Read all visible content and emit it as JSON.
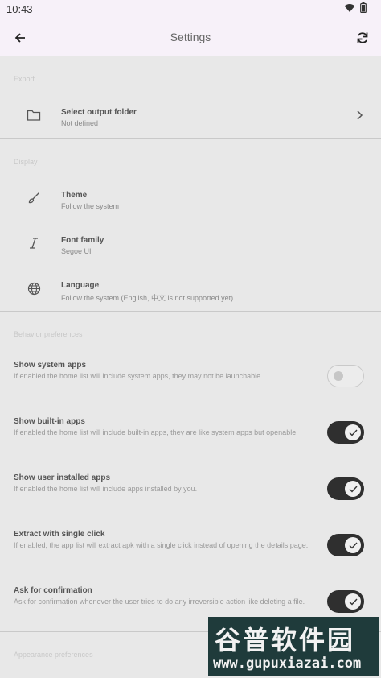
{
  "status_bar": {
    "time": "10:43"
  },
  "appbar": {
    "title": "Settings"
  },
  "export": {
    "label": "Export",
    "items": [
      {
        "title": "Select output folder",
        "subtitle": "Not defined"
      }
    ]
  },
  "display": {
    "label": "Display",
    "items": [
      {
        "title": "Theme",
        "subtitle": "Follow the system"
      },
      {
        "title": "Font family",
        "subtitle": "Segoe UI"
      },
      {
        "title": "Language",
        "subtitle": "Follow the system (English, 中文 is not supported yet)"
      }
    ]
  },
  "behavior": {
    "label": "Behavior preferences",
    "items": [
      {
        "title": "Show system apps",
        "description": "If enabled the home list will include system apps, they may not be launchable.",
        "enabled": false
      },
      {
        "title": "Show built-in apps",
        "description": "If enabled the home list will include built-in apps, they are like system apps but openable.",
        "enabled": true
      },
      {
        "title": "Show user installed apps",
        "description": "If enabled the home list will include apps installed by you.",
        "enabled": true
      },
      {
        "title": "Extract with single click",
        "description": "If enabled, the app list will extract apk with a single click instead of opening the details page.",
        "enabled": true
      },
      {
        "title": "Ask for confirmation",
        "description": "Ask for confirmation whenever the user tries to do any irreversible action like deleting a file.",
        "enabled": true
      }
    ]
  },
  "appearance": {
    "label": "Appearance preferences"
  },
  "watermark": {
    "text": "谷普软件园",
    "url": "www.gupuxiazai.com"
  },
  "icons": {
    "back": "arrow-left-icon",
    "refresh": "refresh-icon",
    "folder": "folder-icon",
    "brush": "brush-icon",
    "italic": "italic-font-icon",
    "globe": "globe-icon",
    "chevron": "chevron-right-icon",
    "check": "check-icon"
  },
  "colors": {
    "appbar_bg": "#f7f1f9",
    "toggle_on": "#2f2f2f",
    "background": "#e8e8e8"
  }
}
